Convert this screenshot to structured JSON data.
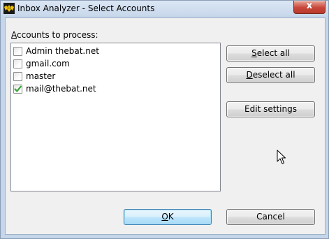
{
  "window": {
    "title": "Inbox Analyzer - Select Accounts",
    "close_glyph": "x"
  },
  "accounts_label": {
    "prefix": "",
    "mnemonic": "A",
    "rest": "ccounts to process:"
  },
  "accounts": [
    {
      "label": "Admin thebat.net",
      "checked": false
    },
    {
      "label": "gmail.com",
      "checked": false
    },
    {
      "label": "master",
      "checked": false
    },
    {
      "label": "mail@thebat.net",
      "checked": true
    }
  ],
  "buttons": {
    "select_all": {
      "mnemonic": "S",
      "rest": "elect all"
    },
    "deselect_all": {
      "mnemonic": "D",
      "rest": "eselect all"
    },
    "edit_settings": "Edit settings",
    "ok": {
      "mnemonic": "O",
      "rest": "K"
    },
    "cancel": "Cancel"
  },
  "colors": {
    "check_mark": "#3aa23a",
    "titlebar": "#c6d6ea",
    "close_button": "#c8463a"
  },
  "icons": {
    "app": "bat-icon",
    "close": "close-icon",
    "cursor": "mouse-pointer-icon"
  }
}
